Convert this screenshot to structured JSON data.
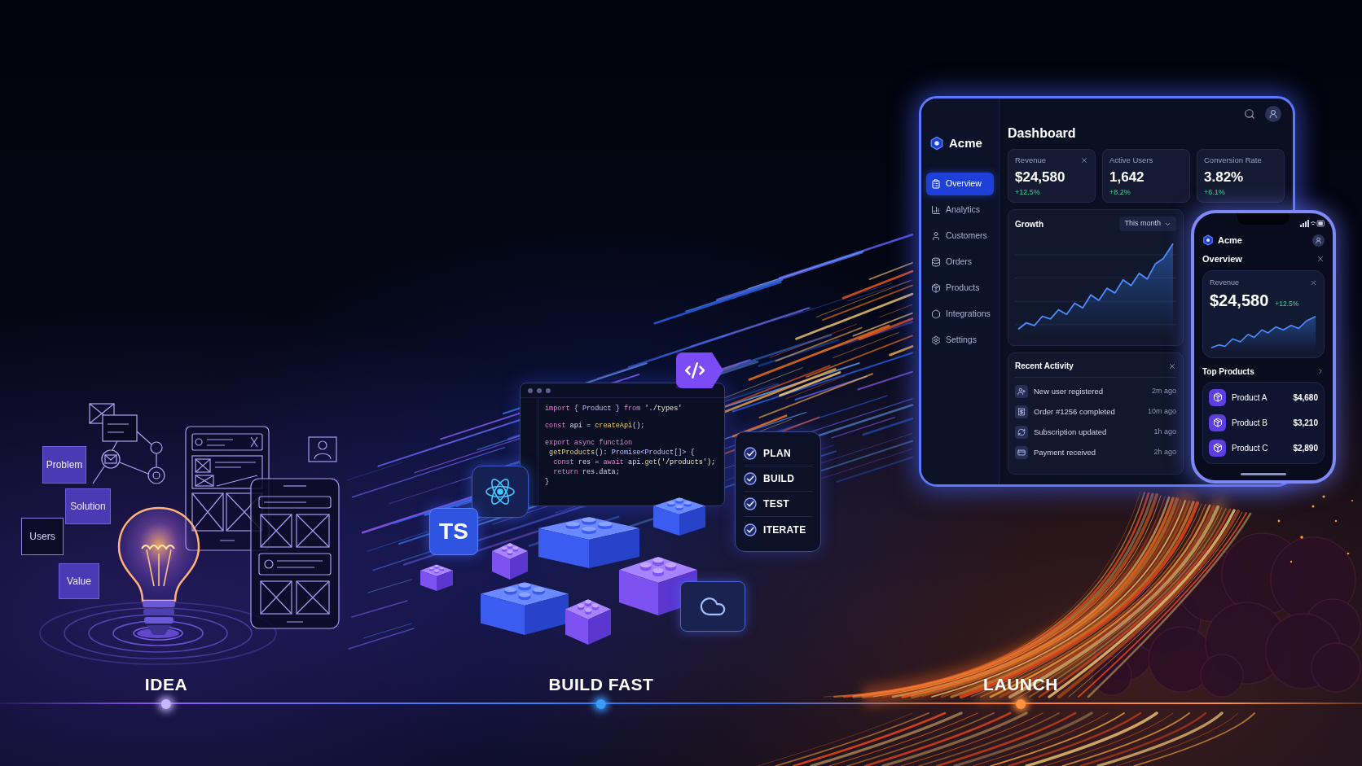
{
  "idea": {
    "notes": [
      {
        "text": "Problem",
        "kind": "filled"
      },
      {
        "text": "Solution",
        "kind": "filled"
      },
      {
        "text": "Users",
        "kind": "outline"
      },
      {
        "text": "Value",
        "kind": "filled"
      }
    ]
  },
  "build": {
    "code": {
      "blocks": [
        {
          "lines": [
            {
              "tokens": [
                {
                  "text": "import",
                  "kind": "keyword"
                },
                {
                  "text": " { Product } ",
                  "kind": "type"
                },
                {
                  "text": "from",
                  "kind": "keyword"
                },
                {
                  "text": " './types'",
                  "kind": "string"
                }
              ]
            }
          ]
        },
        {
          "lines": [
            {
              "tokens": [
                {
                  "text": "const",
                  "kind": "keyword"
                },
                {
                  "text": " api = ",
                  "kind": "plain"
                },
                {
                  "text": "createApi",
                  "kind": "function"
                },
                {
                  "text": "();",
                  "kind": "plain"
                }
              ]
            }
          ]
        },
        {
          "lines": [
            {
              "tokens": [
                {
                  "text": "export async function",
                  "kind": "keyword"
                }
              ]
            },
            {
              "tokens": [
                {
                  "text": " getProducts",
                  "kind": "function"
                },
                {
                  "text": "(): ",
                  "kind": "plain"
                },
                {
                  "text": "Promise<Product[]>",
                  "kind": "type"
                },
                {
                  "text": " {",
                  "kind": "plain"
                }
              ]
            },
            {
              "tokens": [
                {
                  "text": "  const",
                  "kind": "keyword"
                },
                {
                  "text": " res = ",
                  "kind": "plain"
                },
                {
                  "text": "await",
                  "kind": "keyword"
                },
                {
                  "text": " api.",
                  "kind": "plain"
                },
                {
                  "text": "get",
                  "kind": "function"
                },
                {
                  "text": "('/products');",
                  "kind": "string"
                }
              ]
            },
            {
              "tokens": [
                {
                  "text": "  return",
                  "kind": "keyword"
                },
                {
                  "text": " res.data;",
                  "kind": "plain"
                }
              ]
            },
            {
              "tokens": [
                {
                  "text": "}",
                  "kind": "plain"
                }
              ]
            }
          ]
        }
      ]
    },
    "language_tile": "TS",
    "checklist": [
      {
        "label": "PLAN",
        "checked": true
      },
      {
        "label": "BUILD",
        "checked": true
      },
      {
        "label": "TEST",
        "checked": true
      },
      {
        "label": "ITERATE",
        "checked": true
      }
    ]
  },
  "launch": {
    "tablet": {
      "brand": "Acme",
      "nav": [
        {
          "label": "Overview",
          "selected": true
        },
        {
          "label": "Analytics",
          "selected": false
        },
        {
          "label": "Customers",
          "selected": false
        },
        {
          "label": "Orders",
          "selected": false
        },
        {
          "label": "Products",
          "selected": false
        },
        {
          "label": "Integrations",
          "selected": false
        },
        {
          "label": "Settings",
          "selected": false
        }
      ],
      "title": "Dashboard",
      "stats": [
        {
          "label": "Revenue",
          "value": "$24,580",
          "change": "+12.5%",
          "closable": true
        },
        {
          "label": "Active Users",
          "value": "1,642",
          "change": "+8.2%",
          "closable": false
        },
        {
          "label": "Conversion Rate",
          "value": "3.82%",
          "change": "+6.1%",
          "closable": false
        }
      ],
      "growth": {
        "title": "Growth",
        "period": "This month"
      },
      "activity": {
        "title": "Recent Activity",
        "items": [
          {
            "text": "New user registered",
            "time": "2m ago"
          },
          {
            "text": "Order #1256 completed",
            "time": "10m ago"
          },
          {
            "text": "Subscription updated",
            "time": "1h ago"
          },
          {
            "text": "Payment received",
            "time": "2h ago"
          }
        ]
      }
    },
    "phone": {
      "brand": "Acme",
      "title": "Overview",
      "revenue": {
        "label": "Revenue",
        "value": "$24,580",
        "change": "+12.5%"
      },
      "products_title": "Top Products",
      "products": [
        {
          "name": "Product A",
          "price": "$4,680"
        },
        {
          "name": "Product B",
          "price": "$3,210"
        },
        {
          "name": "Product C",
          "price": "$2,890"
        }
      ]
    }
  },
  "timeline": [
    {
      "label": "IDEA",
      "color": "#c4b5fd"
    },
    {
      "label": "BUILD FAST",
      "color": "#3b9bff"
    },
    {
      "label": "LAUNCH",
      "color": "#ff9440"
    }
  ]
}
